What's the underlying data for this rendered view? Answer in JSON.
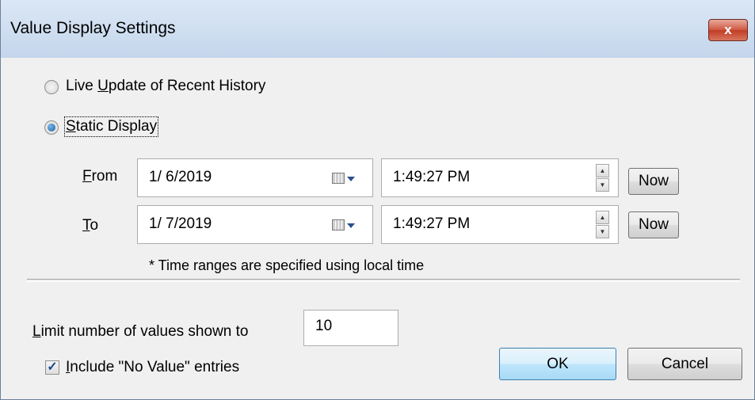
{
  "window": {
    "title": "Value Display Settings",
    "close_label": "x"
  },
  "mode": {
    "live_label_pre": "Live ",
    "live_label_key": "U",
    "live_label_post": "pdate of Recent History",
    "static_label_key": "S",
    "static_label_post": "tatic Display",
    "selected": "static"
  },
  "range": {
    "from": {
      "label_key": "F",
      "label_post": "rom",
      "date": "1/ 6/2019",
      "time": "1:49:27 PM",
      "now_label": "Now"
    },
    "to": {
      "label_key": "T",
      "label_post": "o",
      "date": "1/ 7/2019",
      "time": "1:49:27 PM",
      "now_label": "Now"
    },
    "note": "* Time ranges are specified using local time"
  },
  "limit": {
    "label_key": "L",
    "label_post": "imit number of values shown to",
    "value": "10"
  },
  "include": {
    "label_key": "I",
    "label_post": "nclude \"No Value\" entries",
    "checked": true,
    "check_glyph": "✓"
  },
  "buttons": {
    "ok": "OK",
    "cancel": "Cancel"
  }
}
